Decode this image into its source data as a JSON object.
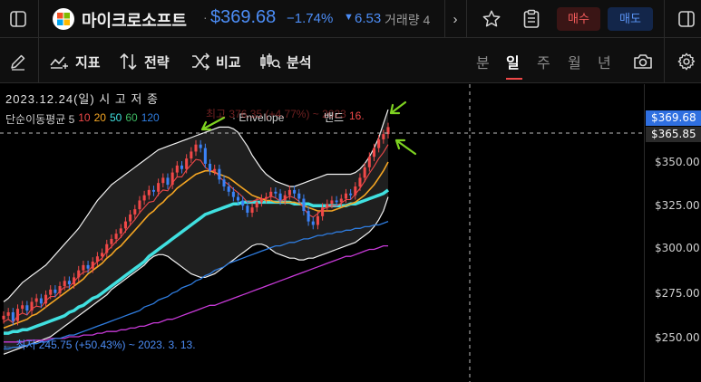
{
  "header": {
    "title": "마이크로소프트",
    "price": "$369.68",
    "change_pct": "−1.74%",
    "change_abs": "6.53",
    "volume_label": "거래량 4",
    "buy_label": "매수",
    "sell_label": "매도"
  },
  "toolbar": {
    "indicator_label": "지표",
    "strategy_label": "전략",
    "compare_label": "비교",
    "analysis_label": "분석",
    "timeframes": [
      "분",
      "일",
      "주",
      "월",
      "년"
    ],
    "active_timeframe": "일"
  },
  "legend": {
    "date_line": "2023.12.24(일) 시 고 저 종",
    "sma_label": "단순이동평균 5",
    "sma_values": [
      {
        "text": "10",
        "color": "#f04848"
      },
      {
        "text": "20",
        "color": "#f5a623"
      },
      {
        "text": "50",
        "color": "#40e0e0"
      },
      {
        "text": "60",
        "color": "#3db863"
      },
      {
        "text": "120",
        "color": "#2f7de0"
      }
    ],
    "envelope_label": "· Envelope",
    "high_annotation": "최고 376.35 (+4.77%) ~ 2023. 12. 1…",
    "band_label": "밴드",
    "band_value": "16.",
    "low_annotation": "← 최저 245.75 (+50.43%) ~ 2023. 3. 13."
  },
  "price_axis": {
    "labels": [
      "$350.00",
      "$325.00",
      "$300.00",
      "$275.00",
      "$250.00"
    ],
    "current_price_tag": "$369.68",
    "crosshair_price_tag": "$365.85"
  },
  "colors": {
    "up": "#f04848",
    "down": "#3b82f6",
    "accent_blue": "#3d8bfd",
    "sma50": "#40e0e0",
    "sma20": "#f5a623",
    "sma120": "#2f7de0",
    "sma240": "#c83ad8",
    "arrow": "#7ed321"
  },
  "chart_data": {
    "type": "candlestick",
    "title": "마이크로소프트",
    "ylim": [
      240,
      380
    ],
    "y_ticks": [
      250,
      275,
      300,
      325,
      350
    ],
    "last_price": 369.68,
    "crosshair_price": 365.85,
    "annotations": [
      {
        "text": "최고 376.35 (+4.77%) ~ 2023. 12. 1…",
        "value": 376.35
      },
      {
        "text": "최저 245.75 (+50.43%) ~ 2023. 3. 13.",
        "value": 245.75
      }
    ],
    "closes": [
      262,
      264,
      259,
      266,
      268,
      265,
      270,
      272,
      269,
      274,
      277,
      275,
      279,
      282,
      280,
      284,
      288,
      291,
      289,
      293,
      296,
      298,
      303,
      306,
      309,
      312,
      316,
      320,
      323,
      328,
      331,
      334,
      333,
      338,
      341,
      337,
      344,
      348,
      346,
      352,
      356,
      360,
      358,
      349,
      345,
      346,
      340,
      336,
      333,
      330,
      328,
      325,
      321,
      324,
      327,
      329,
      330,
      333,
      332,
      328,
      331,
      334,
      332,
      329,
      322,
      316,
      314,
      319,
      324,
      326,
      328,
      327,
      329,
      332,
      331,
      336,
      341,
      347,
      353,
      358,
      363,
      366,
      370
    ],
    "sma20": [
      255,
      256,
      257,
      258,
      259,
      260,
      262,
      263,
      265,
      267,
      269,
      271,
      273,
      275,
      277,
      279,
      281,
      283,
      286,
      288,
      290,
      292,
      295,
      297,
      300,
      302,
      305,
      308,
      311,
      314,
      317,
      320,
      322,
      325,
      327,
      330,
      332,
      335,
      337,
      339,
      341,
      343,
      344,
      345,
      345,
      344,
      343,
      342,
      341,
      339,
      337,
      335,
      333,
      331,
      330,
      329,
      328,
      328,
      327,
      327,
      327,
      327,
      327,
      326,
      325,
      324,
      323,
      322,
      322,
      322,
      322,
      323,
      324,
      325,
      326,
      327,
      329,
      331,
      334,
      337,
      341,
      345,
      350
    ],
    "sma50": [
      252,
      252,
      253,
      253,
      254,
      254,
      255,
      256,
      257,
      258,
      259,
      260,
      261,
      262,
      264,
      265,
      267,
      268,
      270,
      272,
      273,
      275,
      277,
      279,
      281,
      283,
      285,
      287,
      289,
      291,
      293,
      296,
      298,
      300,
      302,
      304,
      306,
      308,
      310,
      312,
      314,
      316,
      318,
      320,
      321,
      322,
      323,
      324,
      325,
      326,
      326,
      327,
      327,
      327,
      327,
      327,
      327,
      327,
      327,
      327,
      327,
      327,
      326,
      326,
      326,
      326,
      325,
      325,
      325,
      325,
      325,
      325,
      325,
      325,
      326,
      326,
      327,
      328,
      329,
      330,
      331,
      332,
      334
    ],
    "sma120": [
      243,
      243,
      244,
      244,
      245,
      245,
      246,
      246,
      247,
      247,
      248,
      249,
      249,
      250,
      251,
      251,
      252,
      253,
      254,
      255,
      256,
      257,
      258,
      259,
      260,
      261,
      262,
      263,
      264,
      265,
      267,
      268,
      269,
      271,
      272,
      273,
      275,
      276,
      278,
      279,
      280,
      282,
      283,
      285,
      286,
      288,
      289,
      290,
      292,
      293,
      294,
      295,
      296,
      297,
      298,
      299,
      300,
      301,
      302,
      302,
      303,
      304,
      304,
      305,
      306,
      306,
      307,
      308,
      308,
      309,
      309,
      310,
      310,
      311,
      311,
      312,
      312,
      313,
      313,
      314,
      314,
      315,
      316
    ],
    "sma240": [
      247,
      247,
      247,
      247,
      247,
      248,
      248,
      248,
      248,
      248,
      249,
      249,
      249,
      249,
      250,
      250,
      250,
      251,
      251,
      251,
      252,
      252,
      253,
      253,
      253,
      254,
      254,
      255,
      255,
      256,
      256,
      257,
      258,
      258,
      259,
      260,
      260,
      261,
      262,
      263,
      264,
      265,
      266,
      267,
      268,
      268,
      269,
      270,
      271,
      272,
      273,
      274,
      275,
      276,
      277,
      278,
      279,
      280,
      281,
      282,
      283,
      284,
      285,
      286,
      287,
      288,
      289,
      290,
      291,
      292,
      293,
      294,
      295,
      296,
      296,
      297,
      298,
      299,
      300,
      300,
      301,
      302,
      302
    ],
    "envelope_upper": [
      270,
      272,
      275,
      278,
      281,
      283,
      285,
      287,
      289,
      291,
      294,
      297,
      300,
      303,
      306,
      309,
      312,
      316,
      320,
      324,
      328,
      331,
      334,
      337,
      339,
      341,
      343,
      345,
      347,
      349,
      351,
      353,
      355,
      357,
      358,
      359,
      360,
      361,
      362,
      363,
      364,
      365,
      366,
      367,
      368,
      369,
      370,
      370,
      370,
      369,
      367,
      363,
      359,
      354,
      350,
      346,
      343,
      341,
      339,
      338,
      337,
      336,
      336,
      337,
      338,
      339,
      340,
      341,
      342,
      343,
      343,
      343,
      343,
      343,
      343,
      344,
      346,
      349,
      353,
      358,
      364,
      372,
      380
    ],
    "envelope_lower": [
      240,
      241,
      242,
      243,
      244,
      245,
      246,
      247,
      248,
      249,
      250,
      252,
      254,
      256,
      258,
      260,
      262,
      264,
      266,
      268,
      270,
      272,
      274,
      277,
      279,
      281,
      283,
      285,
      287,
      289,
      291,
      294,
      296,
      297,
      297,
      296,
      294,
      292,
      290,
      288,
      286,
      285,
      284,
      284,
      285,
      286,
      288,
      290,
      292,
      294,
      296,
      298,
      300,
      302,
      303,
      303,
      302,
      300,
      298,
      297,
      296,
      295,
      295,
      294,
      294,
      295,
      295,
      296,
      297,
      298,
      299,
      300,
      301,
      302,
      303,
      304,
      306,
      308,
      310,
      313,
      317,
      322,
      330
    ]
  }
}
